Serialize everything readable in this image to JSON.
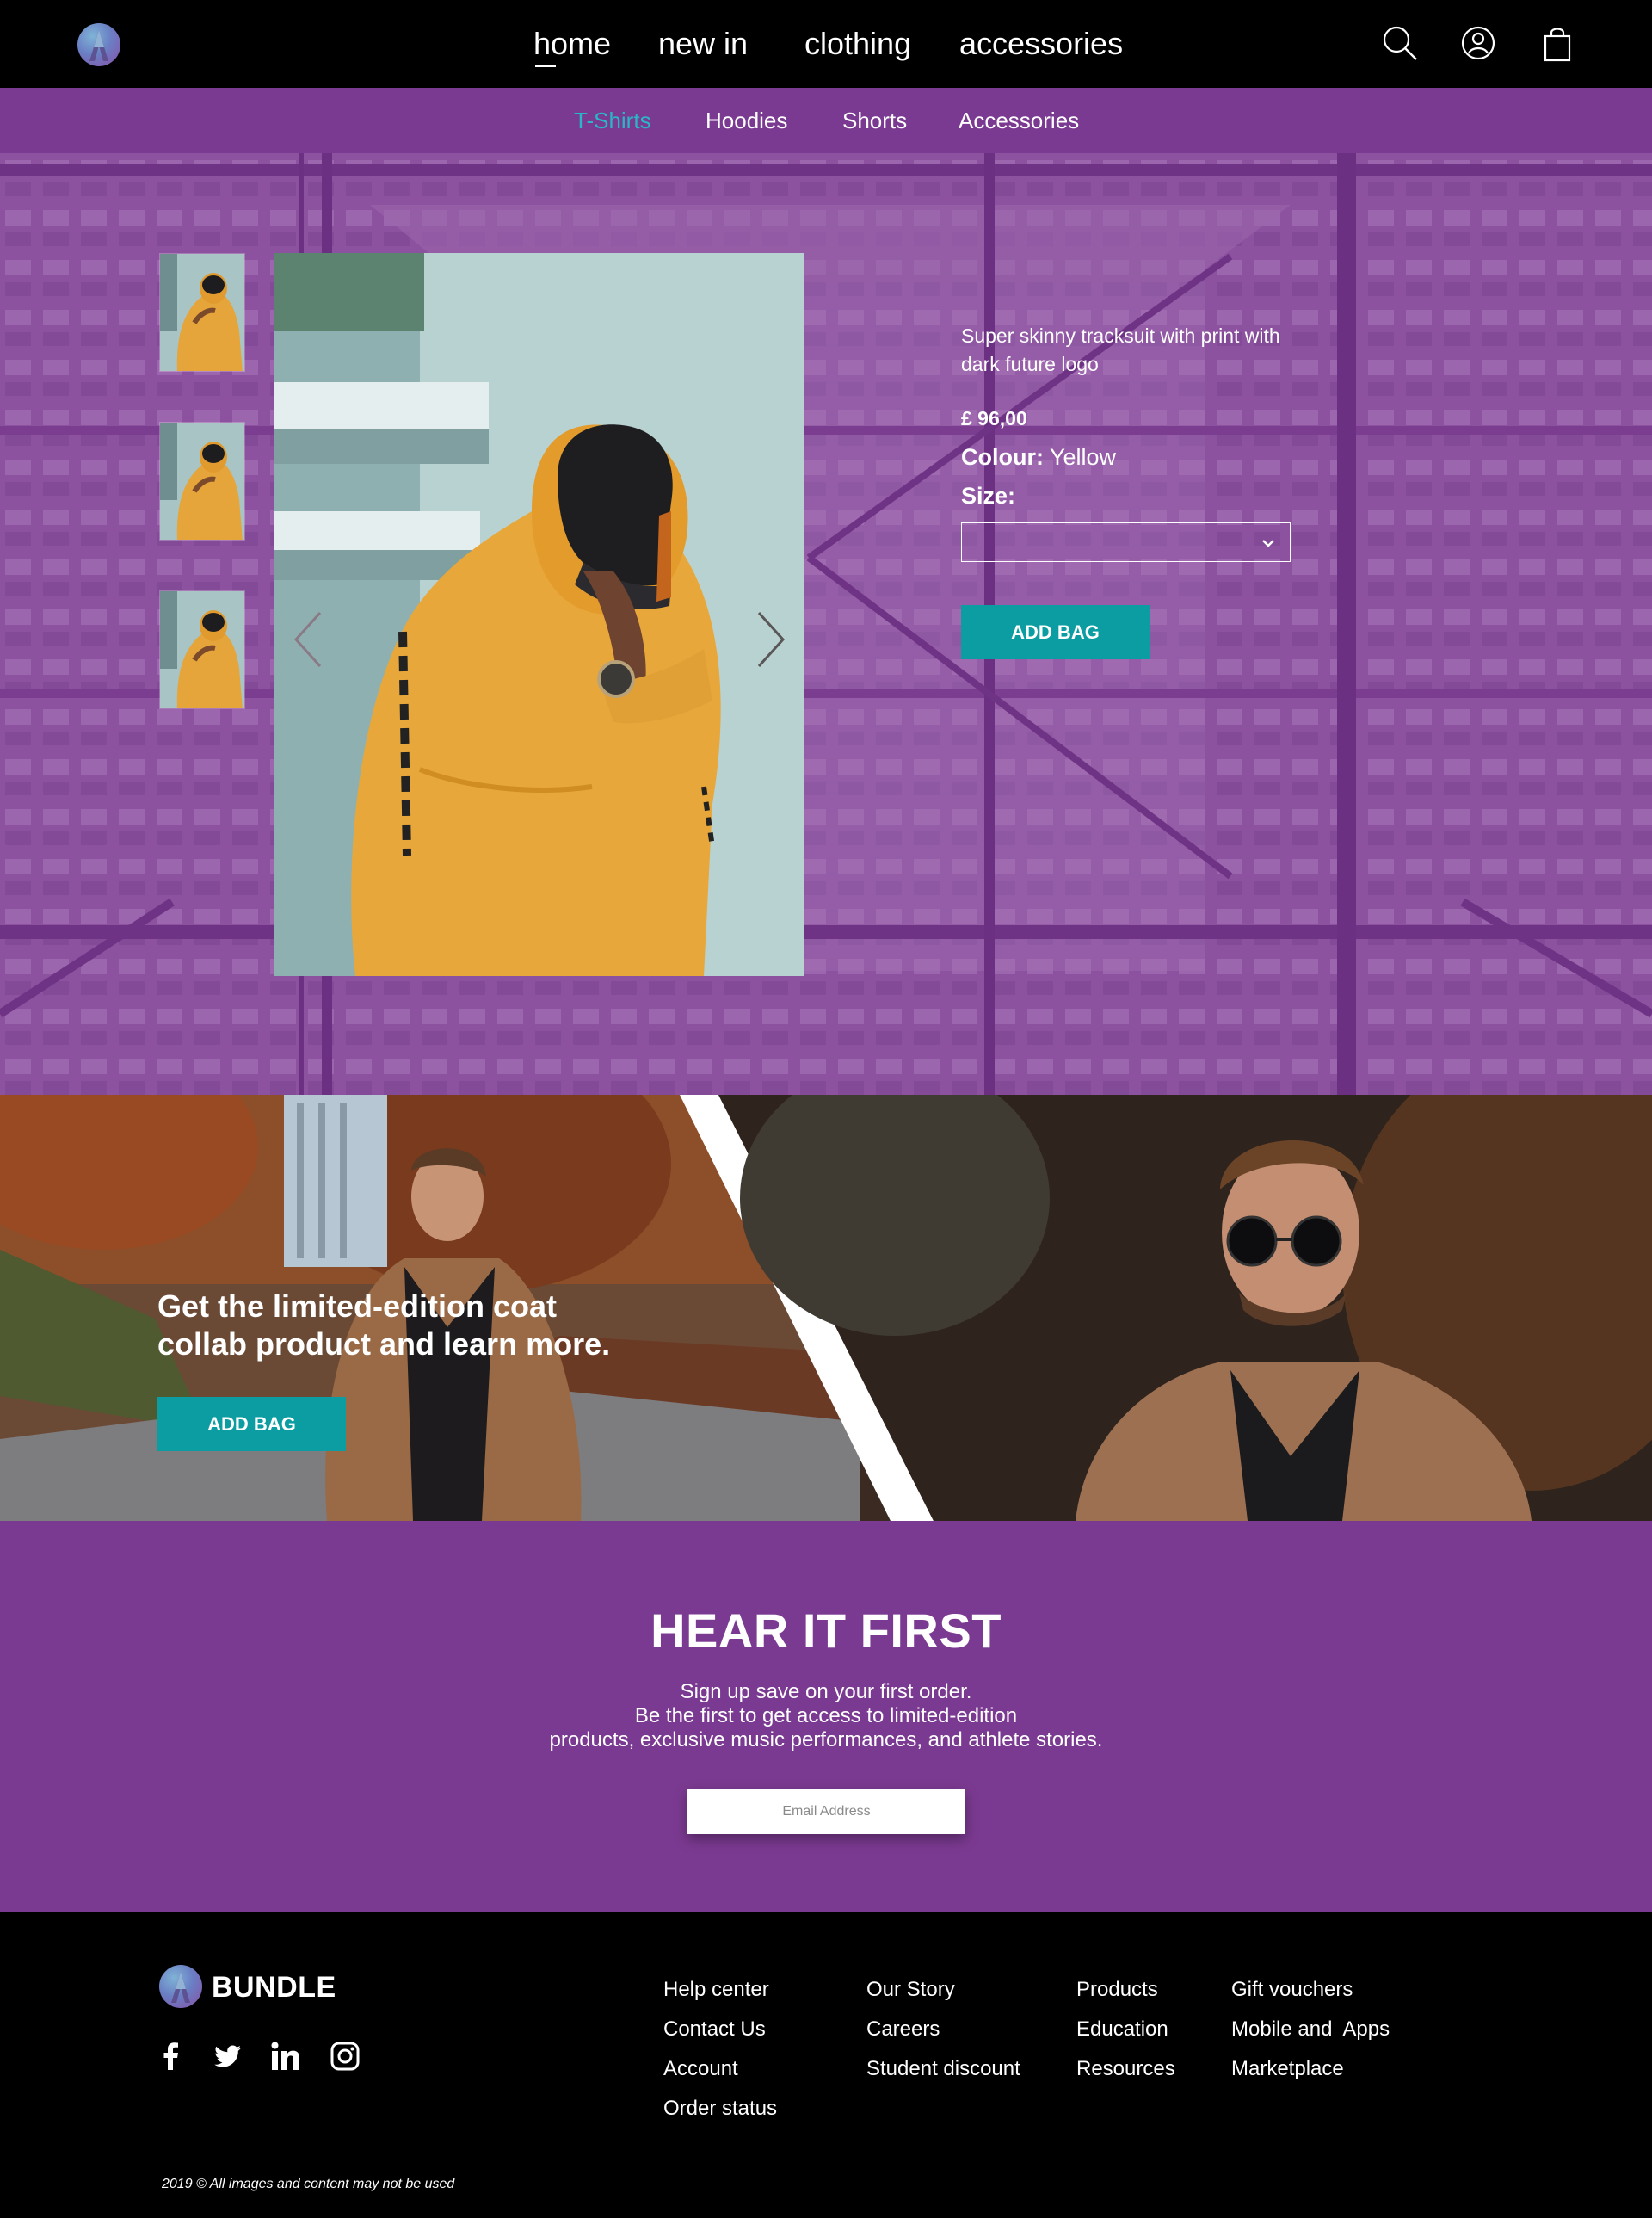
{
  "nav": {
    "links": [
      {
        "label": "home"
      },
      {
        "label": "new in"
      },
      {
        "label": "clothing"
      },
      {
        "label": "accessories"
      }
    ],
    "icons": [
      "search-icon",
      "user-icon",
      "shopping-bag-icon"
    ]
  },
  "subnav": {
    "items": [
      {
        "label": "T-Shirts",
        "active": true
      },
      {
        "label": "Hoodies"
      },
      {
        "label": "Shorts"
      },
      {
        "label": "Accessories"
      }
    ]
  },
  "product": {
    "description": "Super skinny tracksuit with print with dark future logo",
    "price": "£ 96,00",
    "colour_label": "Colour:",
    "colour_value": "Yellow",
    "size_label": "Size:",
    "size_value": "",
    "button": "ADD BAG"
  },
  "promo": {
    "headline_line1": "Get the limited-edition coat",
    "headline_line2": "collab product and learn more.",
    "button": "ADD BAG"
  },
  "newsletter": {
    "title": "HEAR IT FIRST",
    "line1": "Sign up save on your first order.",
    "line2": "Be the first to get access to limited-edition",
    "line3": "products, exclusive music performances, and athlete stories.",
    "email_placeholder": "Email Address"
  },
  "footer": {
    "brand": "BUNDLE",
    "social": [
      "facebook-icon",
      "twitter-icon",
      "linkedin-icon",
      "instagram-icon"
    ],
    "columns": [
      [
        "Help center",
        "Contact Us",
        "Account",
        "Order status"
      ],
      [
        "Our Story",
        "Careers",
        "Student discount"
      ],
      [
        "Products",
        "Education",
        "Resources"
      ],
      [
        "Gift vouchers",
        "Mobile and  Apps",
        "Marketplace"
      ]
    ],
    "copyright": "2019 © All images and content may not be used"
  },
  "colors": {
    "purple": "#7b3a91",
    "teal": "#0b9da2",
    "active_link": "#2bb6c6",
    "black": "#000000"
  }
}
